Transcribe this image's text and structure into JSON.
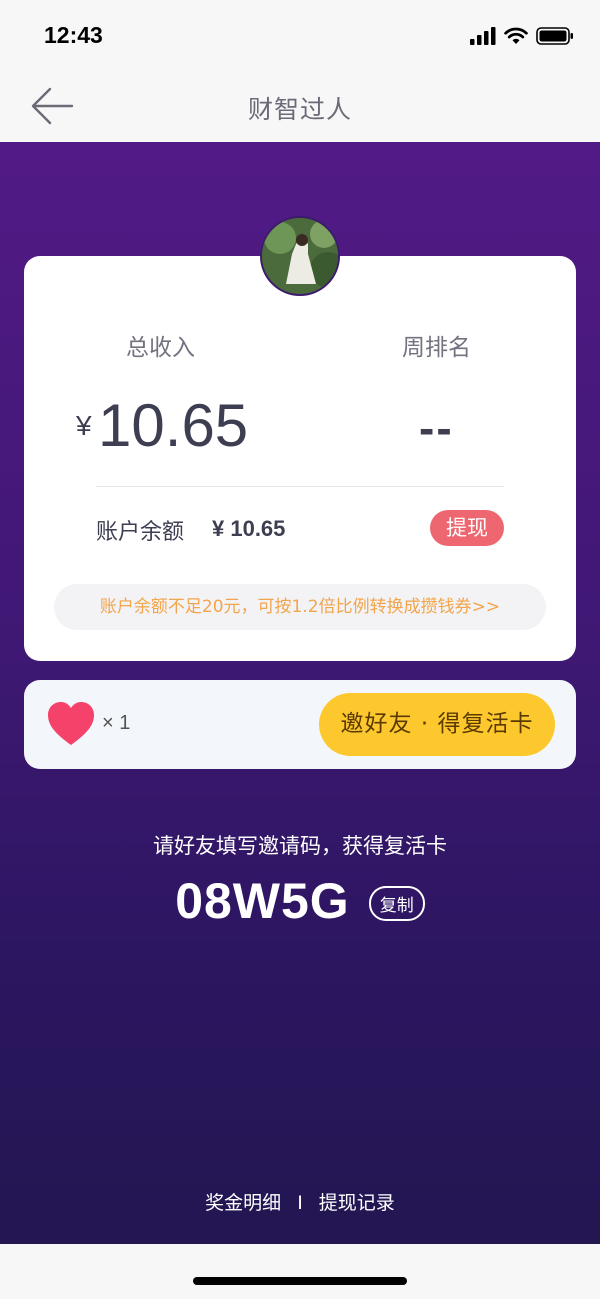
{
  "status_bar": {
    "time": "12:43"
  },
  "nav": {
    "title": "财智过人"
  },
  "income_card": {
    "total_income_label": "总收入",
    "weekly_rank_label": "周排名",
    "currency": "¥",
    "total_income": "10.65",
    "weekly_rank": "--",
    "balance_label": "账户余额",
    "balance_value": "¥ 10.65",
    "withdraw_label": "提现",
    "notice": "账户余额不足20元，可按1.2倍比例转换成攒钱券>>"
  },
  "revive": {
    "count": "× 1",
    "invite_button": "邀好友 · 得复活卡"
  },
  "invite": {
    "text": "请好友填写邀请码，获得复活卡",
    "code": "08W5G",
    "copy_label": "复制"
  },
  "footer": {
    "bonus_detail": "奖金明细",
    "separator": "I",
    "withdraw_record": "提现记录"
  },
  "colors": {
    "purple_top": "#521a86",
    "purple_bottom": "#231651",
    "withdraw_red": "#ee6670",
    "invite_yellow": "#fdc82e",
    "notice_orange": "#f2a54a",
    "heart_pink": "#f4426a"
  },
  "icons": [
    "back-arrow-icon",
    "signal-icon",
    "wifi-icon",
    "battery-icon",
    "heart-icon"
  ]
}
